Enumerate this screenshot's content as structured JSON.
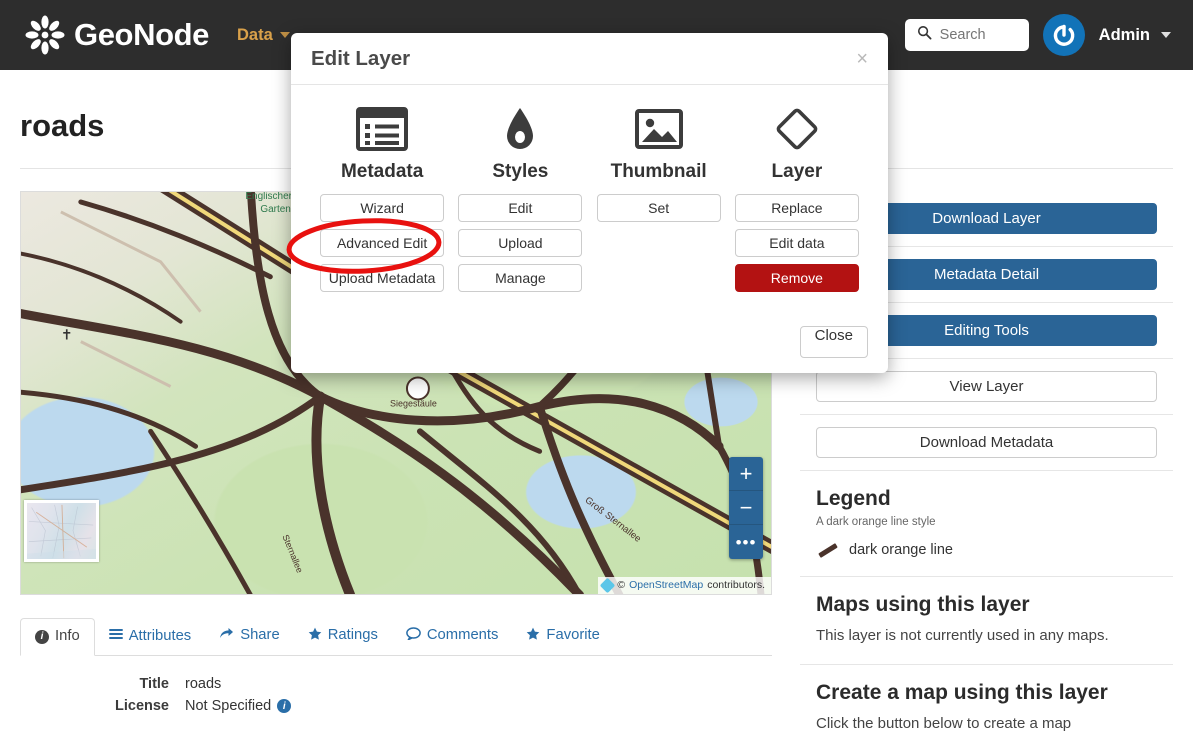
{
  "navbar": {
    "brand": "GeoNode",
    "links": [
      {
        "label": "Data",
        "active": true,
        "caret": true
      }
    ],
    "search": {
      "placeholder": "Search",
      "value": ""
    },
    "user": {
      "label": "Admin"
    }
  },
  "page": {
    "title": "roads"
  },
  "map": {
    "zoom_in": "+",
    "zoom_out": "−",
    "more": "•••",
    "attribution_prefix": "©",
    "attribution_link": "OpenStreetMap",
    "attribution_suffix": "contributors.",
    "labels": [
      "Englischer",
      "Garten",
      "Groß",
      "Sternallee",
      "Siegesträule"
    ]
  },
  "tabs": [
    {
      "label": "Info",
      "icon": "info-icon",
      "active": true
    },
    {
      "label": "Attributes",
      "icon": "list-icon",
      "active": false
    },
    {
      "label": "Share",
      "icon": "share-icon",
      "active": false
    },
    {
      "label": "Ratings",
      "icon": "star-icon",
      "active": false
    },
    {
      "label": "Comments",
      "icon": "comment-icon",
      "active": false
    },
    {
      "label": "Favorite",
      "icon": "star-icon",
      "active": false
    }
  ],
  "info": {
    "rows": [
      {
        "label": "Title",
        "value": "roads",
        "badge": false
      },
      {
        "label": "License",
        "value": "Not Specified",
        "badge": true
      }
    ]
  },
  "sidebar": {
    "buttons": [
      {
        "label": "Download Layer",
        "style": "primary"
      },
      {
        "label": "Metadata Detail",
        "style": "primary"
      },
      {
        "label": "Editing Tools",
        "style": "primary"
      },
      {
        "label": "View Layer",
        "style": "default"
      },
      {
        "label": "Download Metadata",
        "style": "default"
      }
    ],
    "legend": {
      "heading": "Legend",
      "subtitle": "A dark orange line style",
      "entry": "dark orange line",
      "swatch_color": "#4a332b"
    },
    "maps_using": {
      "heading": "Maps using this layer",
      "text": "This layer is not currently used in any maps."
    },
    "create_map": {
      "heading": "Create a map using this layer",
      "text": "Click the button below to create a map"
    }
  },
  "modal": {
    "title": "Edit Layer",
    "close_symbol": "×",
    "columns": [
      {
        "title": "Metadata",
        "icon": "list-table-icon",
        "buttons": [
          {
            "label": "Wizard",
            "style": "default"
          },
          {
            "label": "Advanced Edit",
            "style": "default"
          },
          {
            "label": "Upload Metadata",
            "style": "default"
          }
        ]
      },
      {
        "title": "Styles",
        "icon": "water-drop-icon",
        "buttons": [
          {
            "label": "Edit",
            "style": "default"
          },
          {
            "label": "Upload",
            "style": "default"
          },
          {
            "label": "Manage",
            "style": "default"
          }
        ]
      },
      {
        "title": "Thumbnail",
        "icon": "image-icon",
        "buttons": [
          {
            "label": "Set",
            "style": "default"
          }
        ]
      },
      {
        "title": "Layer",
        "icon": "diamond-icon",
        "buttons": [
          {
            "label": "Replace",
            "style": "default"
          },
          {
            "label": "Edit data",
            "style": "default"
          },
          {
            "label": "Remove",
            "style": "danger"
          }
        ]
      }
    ],
    "footer_close": "Close"
  },
  "annotation": {
    "shape": "ellipse",
    "color": "#e8110f",
    "target": "Advanced Edit"
  }
}
